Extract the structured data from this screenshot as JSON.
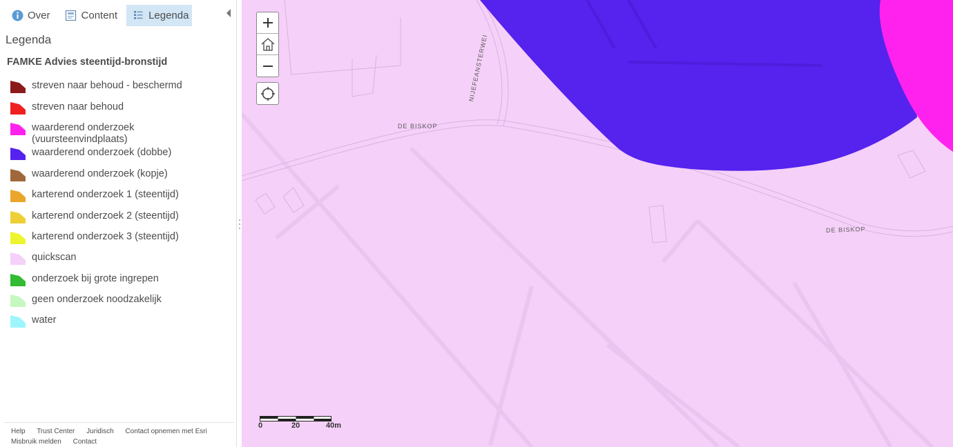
{
  "tabs": [
    {
      "label": "Over",
      "icon": "info-icon"
    },
    {
      "label": "Content",
      "icon": "content-icon"
    },
    {
      "label": "Legenda",
      "icon": "legend-icon",
      "active": true
    }
  ],
  "panel": {
    "title": "Legenda",
    "layer_title": "FAMKE Advies steentijd-bronstijd"
  },
  "legend": [
    {
      "label": "streven naar behoud - beschermd",
      "color": "#8b1a1a"
    },
    {
      "label": "streven naar behoud",
      "color": "#ee2020"
    },
    {
      "label": "waarderend onderzoek (vuursteenvindplaats)",
      "color": "#ff22ee"
    },
    {
      "label": "waarderend onderzoek (dobbe)",
      "color": "#5522ee"
    },
    {
      "label": "waarderend onderzoek (kopje)",
      "color": "#a0683a"
    },
    {
      "label": "karterend onderzoek 1 (steentijd)",
      "color": "#eaa62a"
    },
    {
      "label": "karterend onderzoek 2 (steentijd)",
      "color": "#eed036"
    },
    {
      "label": "karterend onderzoek 3 (steentijd)",
      "color": "#eef530"
    },
    {
      "label": "quickscan",
      "color": "#f5d0f8"
    },
    {
      "label": "onderzoek bij grote ingrepen",
      "color": "#33bb33"
    },
    {
      "label": "geen onderzoek noodzakelijk",
      "color": "#c6f7c0"
    },
    {
      "label": "water",
      "color": "#9ef6fd"
    }
  ],
  "footer": {
    "links": [
      "Help",
      "Trust Center",
      "Juridisch",
      "Contact opnemen met Esri",
      "Misbruik melden",
      "Contact"
    ]
  },
  "map": {
    "road_labels": [
      "DE BISKOP",
      "NIJEFEANSTERWEI",
      "DE BISKOP"
    ],
    "scale": {
      "ticks": [
        "0",
        "20",
        "40m"
      ]
    },
    "colors": {
      "quickscan": "#f5d0f8",
      "dobbe": "#5522ee",
      "vuursteen": "#ff22ee"
    }
  }
}
